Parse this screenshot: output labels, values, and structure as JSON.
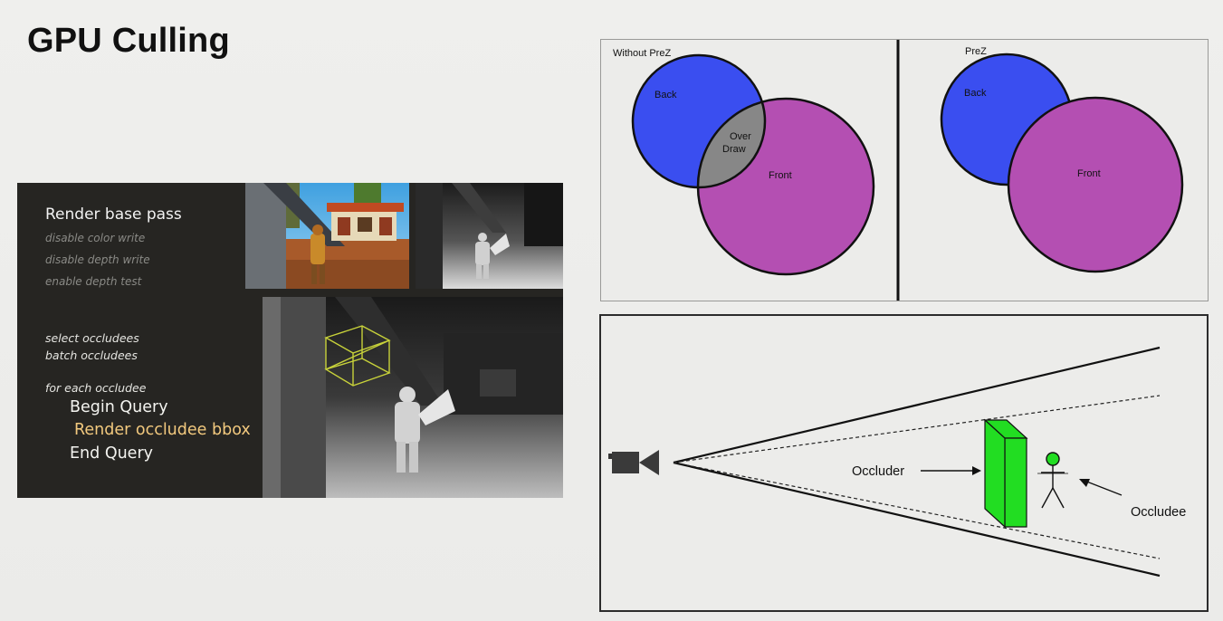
{
  "slide": {
    "title": "GPU Culling"
  },
  "pseudo_code": {
    "render_base_pass": "Render base pass",
    "disable_color_write": "disable color write",
    "disable_depth_write": "disable depth write",
    "enable_depth_test": "enable depth test",
    "select_occludees": "select occludees",
    "batch_occludees": "batch occludees",
    "for_each_occludee": "for each occludee",
    "begin_query": "Begin Query",
    "render_occludee_bbox": "Render occludee bbox",
    "end_query": "End Query"
  },
  "prez_diagram": {
    "left_label": "Without PreZ",
    "right_label": "PreZ",
    "back_label": "Back",
    "front_label": "Front",
    "overdraw_line1": "Over",
    "overdraw_line2": "Draw",
    "colors": {
      "back": "#3a4ef0",
      "front": "#b44fb2",
      "overdraw": "#878787"
    }
  },
  "frustum_diagram": {
    "occluder_label": "Occluder",
    "occludee_label": "Occludee",
    "colors": {
      "occluder": "#22dd22",
      "occludee": "#22dd22"
    }
  },
  "icons": {
    "camera": "camera-icon",
    "stick_figure": "stick-figure-icon"
  }
}
